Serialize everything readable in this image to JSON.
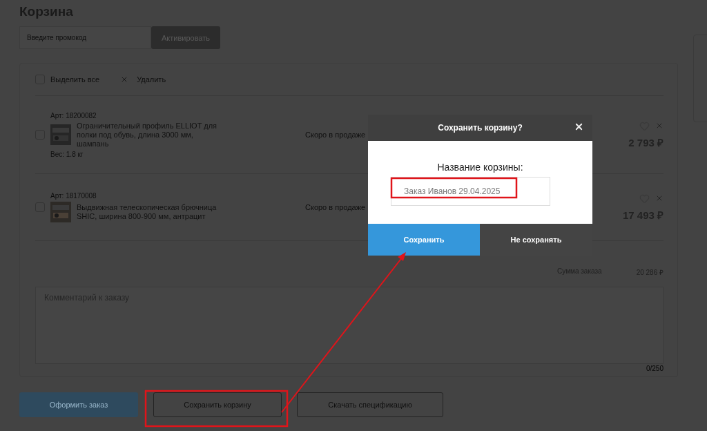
{
  "page": {
    "title": "Корзина"
  },
  "promo": {
    "placeholder": "Введите промокод",
    "button": "Активировать"
  },
  "cart": {
    "select_all": {
      "label": "Выделить все",
      "checked": false
    },
    "delete_label": "Удалить",
    "items": [
      {
        "article": "Арт: 18200082",
        "name": "Ограничительный профиль ELLIOT для полки под обувь, длина 3000 мм, шампань",
        "availability": "Скоро в продаже",
        "weight": "Вес: 1.8 кг",
        "price": "2 793 ₽",
        "checked": false
      },
      {
        "article": "Арт: 18170008",
        "name": "Выдвижная телескопическая брючница SHIC, ширина 800-900 мм, антрацит",
        "availability": "Скоро в продаже",
        "price": "17 493 ₽",
        "checked": false
      }
    ],
    "summary": {
      "label": "Сумма заказа",
      "value": "20 286 ₽"
    },
    "comment": {
      "placeholder": "Комментарий к заказу",
      "counter": "0/250"
    }
  },
  "actions": [
    {
      "label": "Оформить заказ",
      "kind": "primary"
    },
    {
      "label": "Сохранить корзину",
      "kind": "outline"
    },
    {
      "label": "Скачать спецификацию",
      "kind": "outline"
    }
  ],
  "dialog": {
    "title": "Сохранить корзину?",
    "label": "Название корзины:",
    "value": "Заказ Иванов 29.04.2025",
    "buttons": [
      {
        "label": "Сохранить",
        "kind": "primary"
      },
      {
        "label": "Не сохранять",
        "kind": "secondary"
      }
    ]
  }
}
